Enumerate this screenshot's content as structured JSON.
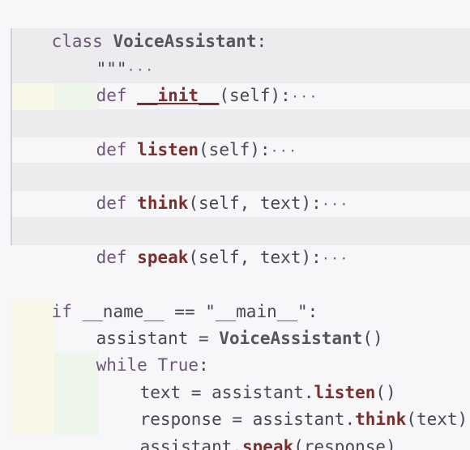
{
  "editor": {
    "class_keyword": "class",
    "class_name": "VoiceAssistant",
    "colon": ":",
    "docstring": "\"\"\"",
    "fold_marker": "···",
    "def_keyword": "def",
    "methods": [
      {
        "name": "__init__",
        "params": "(self):"
      },
      {
        "name": "listen",
        "params": "(self):"
      },
      {
        "name": "think",
        "params": "(self, text):"
      },
      {
        "name": "speak",
        "params": "(self, text):"
      }
    ],
    "if_keyword": "if",
    "main_guard": " __name__ == \"__main__\":",
    "body": {
      "assistant_var": "assistant = ",
      "ctor": "VoiceAssistant",
      "ctor_call": "()",
      "while_keyword": "while",
      "true_keyword": "True",
      "text_assign": "text = assistant.",
      "listen_call": "listen",
      "listen_args": "()",
      "response_assign": "response = assistant.",
      "think_call": "think",
      "think_args": "(text)",
      "speak_prefix": "assistant.",
      "speak_call": "speak",
      "speak_args": "(response)"
    }
  }
}
